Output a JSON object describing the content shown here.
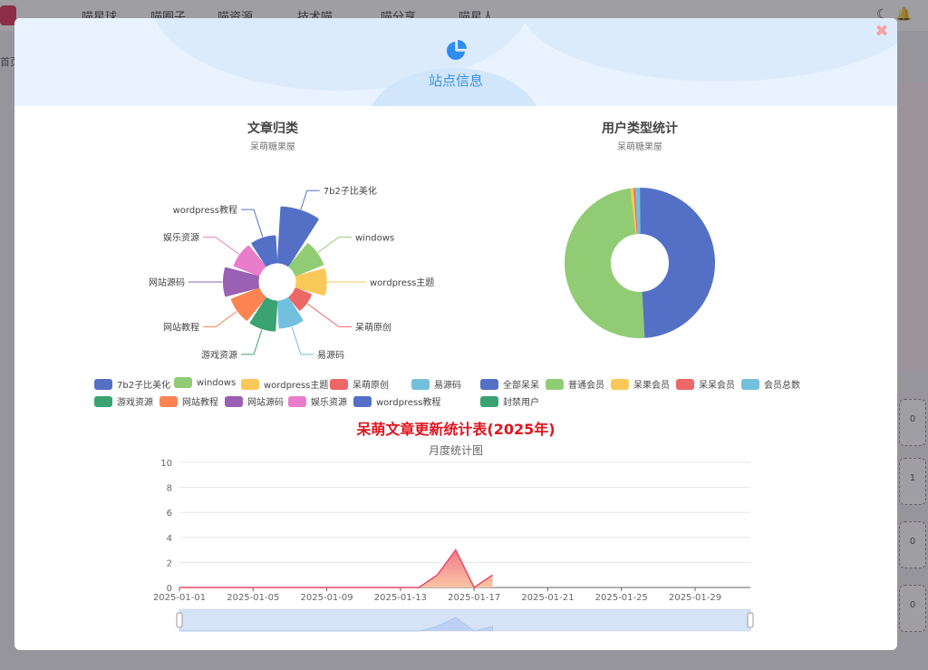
{
  "background": {
    "nav_items": [
      "喵星球",
      "喵圈子",
      "喵资源",
      "技术喵",
      "喵分享",
      "喵星人"
    ],
    "breadcrumb": "首页",
    "side_numbers": [
      "0",
      "1",
      "0",
      "0"
    ]
  },
  "modal": {
    "title": "站点信息",
    "close_glyph": "✖"
  },
  "colors": {
    "palette": [
      "#5470c6",
      "#91cc75",
      "#fac858",
      "#ee6666",
      "#73c0de",
      "#3ba272",
      "#fc8452",
      "#9a60b4",
      "#ea7ccc",
      "#5470c6"
    ]
  },
  "chart_data": [
    {
      "type": "pie",
      "variant": "rose",
      "title": "文章归类",
      "subtitle": "呆萌糖果屋",
      "categories": [
        "7b2子比美化",
        "windows",
        "wordpress主题",
        "呆萌原创",
        "易源码",
        "游戏资源",
        "网站教程",
        "网站源码",
        "娱乐资源",
        "wordpress教程"
      ],
      "values": [
        10,
        2,
        2,
        0.3,
        1.5,
        2,
        2,
        3,
        1.5,
        1.5
      ],
      "legend_position": "bottom"
    },
    {
      "type": "pie",
      "variant": "donut",
      "title": "用户类型统计",
      "subtitle": "呆萌糖果屋",
      "categories": [
        "全部呆呆",
        "普通会员",
        "呆果会员",
        "呆呆会员",
        "会员总数",
        "封禁用户"
      ],
      "values": [
        49,
        49,
        0.7,
        0.3,
        1,
        0
      ],
      "legend_position": "bottom"
    },
    {
      "type": "area",
      "title": "呆萌文章更新统计表(2025年)",
      "subtitle": "月度统计图",
      "x": [
        "2025-01-01",
        "2025-01-02",
        "2025-01-03",
        "2025-01-04",
        "2025-01-05",
        "2025-01-06",
        "2025-01-07",
        "2025-01-08",
        "2025-01-09",
        "2025-01-10",
        "2025-01-11",
        "2025-01-12",
        "2025-01-13",
        "2025-01-14",
        "2025-01-15",
        "2025-01-16",
        "2025-01-17",
        "2025-01-18"
      ],
      "values": [
        0,
        0,
        0,
        0,
        0,
        0,
        0,
        0,
        0,
        0,
        0,
        0,
        0,
        0,
        1,
        3,
        0,
        1
      ],
      "x_ticks": [
        "2025-01-01",
        "2025-01-05",
        "2025-01-09",
        "2025-01-13",
        "2025-01-17",
        "2025-01-21",
        "2025-01-25",
        "2025-01-29"
      ],
      "xlim": [
        "2025-01-01",
        "2025-02-01"
      ],
      "ylim": [
        0,
        10
      ],
      "y_ticks": [
        "0",
        "2",
        "4",
        "6",
        "8",
        "10"
      ],
      "grid": true,
      "data_zoom": true
    }
  ]
}
